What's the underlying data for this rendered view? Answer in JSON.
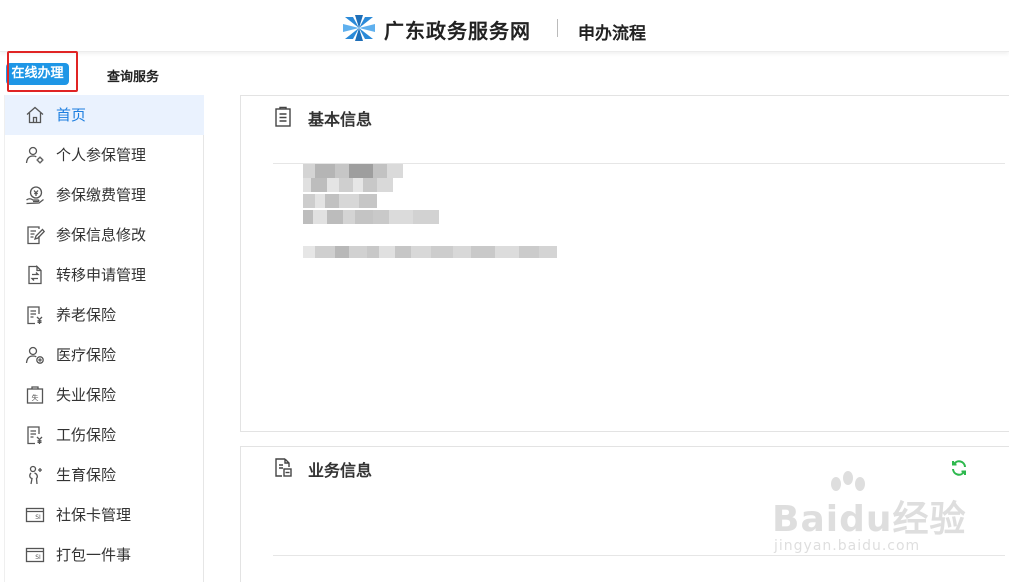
{
  "header": {
    "site_title": "广东政务服务网",
    "subtitle": "申办流程"
  },
  "tabs": {
    "online": "在线办理",
    "query": "查询服务"
  },
  "sidebar": {
    "items": [
      {
        "label": "首页",
        "icon": "home-icon",
        "active": true
      },
      {
        "label": "个人参保管理",
        "icon": "person-settings-icon"
      },
      {
        "label": "参保缴费管理",
        "icon": "payment-icon"
      },
      {
        "label": "参保信息修改",
        "icon": "edit-document-icon"
      },
      {
        "label": "转移申请管理",
        "icon": "transfer-document-icon"
      },
      {
        "label": "养老保险",
        "icon": "pension-document-icon"
      },
      {
        "label": "医疗保险",
        "icon": "medical-person-icon"
      },
      {
        "label": "失业保险",
        "icon": "unemployment-icon"
      },
      {
        "label": "工伤保险",
        "icon": "injury-document-icon"
      },
      {
        "label": "生育保险",
        "icon": "maternity-icon"
      },
      {
        "label": "社保卡管理",
        "icon": "si-card-icon"
      },
      {
        "label": "打包一件事",
        "icon": "package-card-icon"
      }
    ]
  },
  "main": {
    "basic_info": {
      "title": "基本信息",
      "icon": "clipboard-icon"
    },
    "business_info": {
      "title": "业务信息",
      "icon": "document-search-icon",
      "refresh_icon": "refresh-icon"
    }
  },
  "watermark": {
    "brand": "Baidu经验",
    "url": "jingyan.baidu.com"
  },
  "colors": {
    "accent_blue": "#1e96e6",
    "active_bg": "#eaf2fe",
    "active_text": "#1e7fe0",
    "highlight_red": "#e02424",
    "refresh_green": "#2db84d"
  }
}
